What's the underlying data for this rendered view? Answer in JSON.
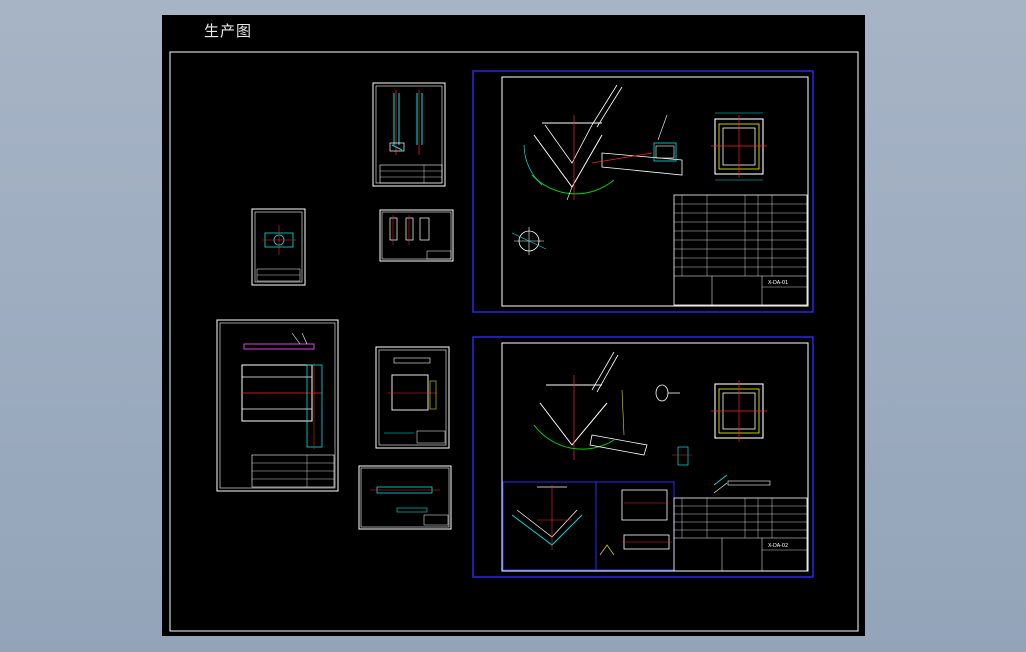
{
  "title": "生产图",
  "colors": {
    "background": "#000000",
    "frame": "#ffffff",
    "selected_sheet": "#2a2aff",
    "line_cyan": "#00e5e5",
    "line_red": "#ff2020",
    "line_yellow": "#e0e000",
    "line_green": "#00d000",
    "line_magenta": "#e040e0"
  },
  "sheets": {
    "sheet_top_right": {
      "title_block_text": "X-DA-01"
    },
    "sheet_bottom_right": {
      "title_block_text": "X-DA-02"
    }
  }
}
